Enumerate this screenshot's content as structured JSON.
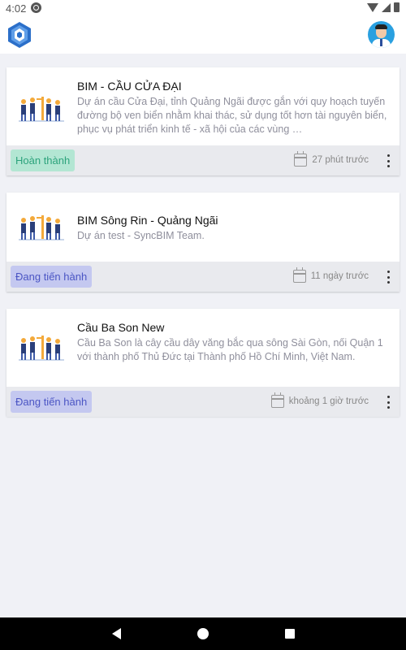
{
  "status_bar": {
    "time": "4:02",
    "icons": [
      "settings-icon",
      "wifi-icon",
      "signal-icon",
      "battery-icon"
    ]
  },
  "app_bar": {
    "logo": "syncbim-logo",
    "avatar": "user-avatar"
  },
  "projects": [
    {
      "title": "BIM - CẦU CỬA ĐẠI",
      "description": "Dự án cầu Cửa Đại, tỉnh Quảng Ngãi được gắn với quy hoạch tuyến đường bộ ven biển nhằm khai thác, sử dụng tốt hơn tài nguyên biển, phục vụ phát triển kinh tế - xã hội của các vùng …",
      "status": "Hoàn thành",
      "time": "27 phút trước"
    },
    {
      "title": "BIM Sông Rin - Quảng Ngãi",
      "description": "Dự án test - SyncBIM Team.",
      "status": "Đang tiến hành",
      "time": "11 ngày trước"
    },
    {
      "title": "Cầu Ba Son New",
      "description": "Cầu Ba Son là cây cầu dây văng bắc qua sông Sài Gòn, nối Quận 1 với thành phố Thủ Đức tại Thành phố Hồ Chí Minh, Việt Nam.",
      "status": "Đang tiến hành",
      "time": "khoảng 1 giờ trước"
    }
  ],
  "colors": {
    "background": "#f0f1f6",
    "badge_done_bg": "#b3e6d3",
    "badge_done_text": "#2da37c",
    "badge_progress_bg": "#c4c8f0",
    "badge_progress_text": "#4b55c4",
    "logo_blue": "#2b6fc9"
  },
  "navigation": [
    "back-button",
    "home-button",
    "recents-button"
  ]
}
